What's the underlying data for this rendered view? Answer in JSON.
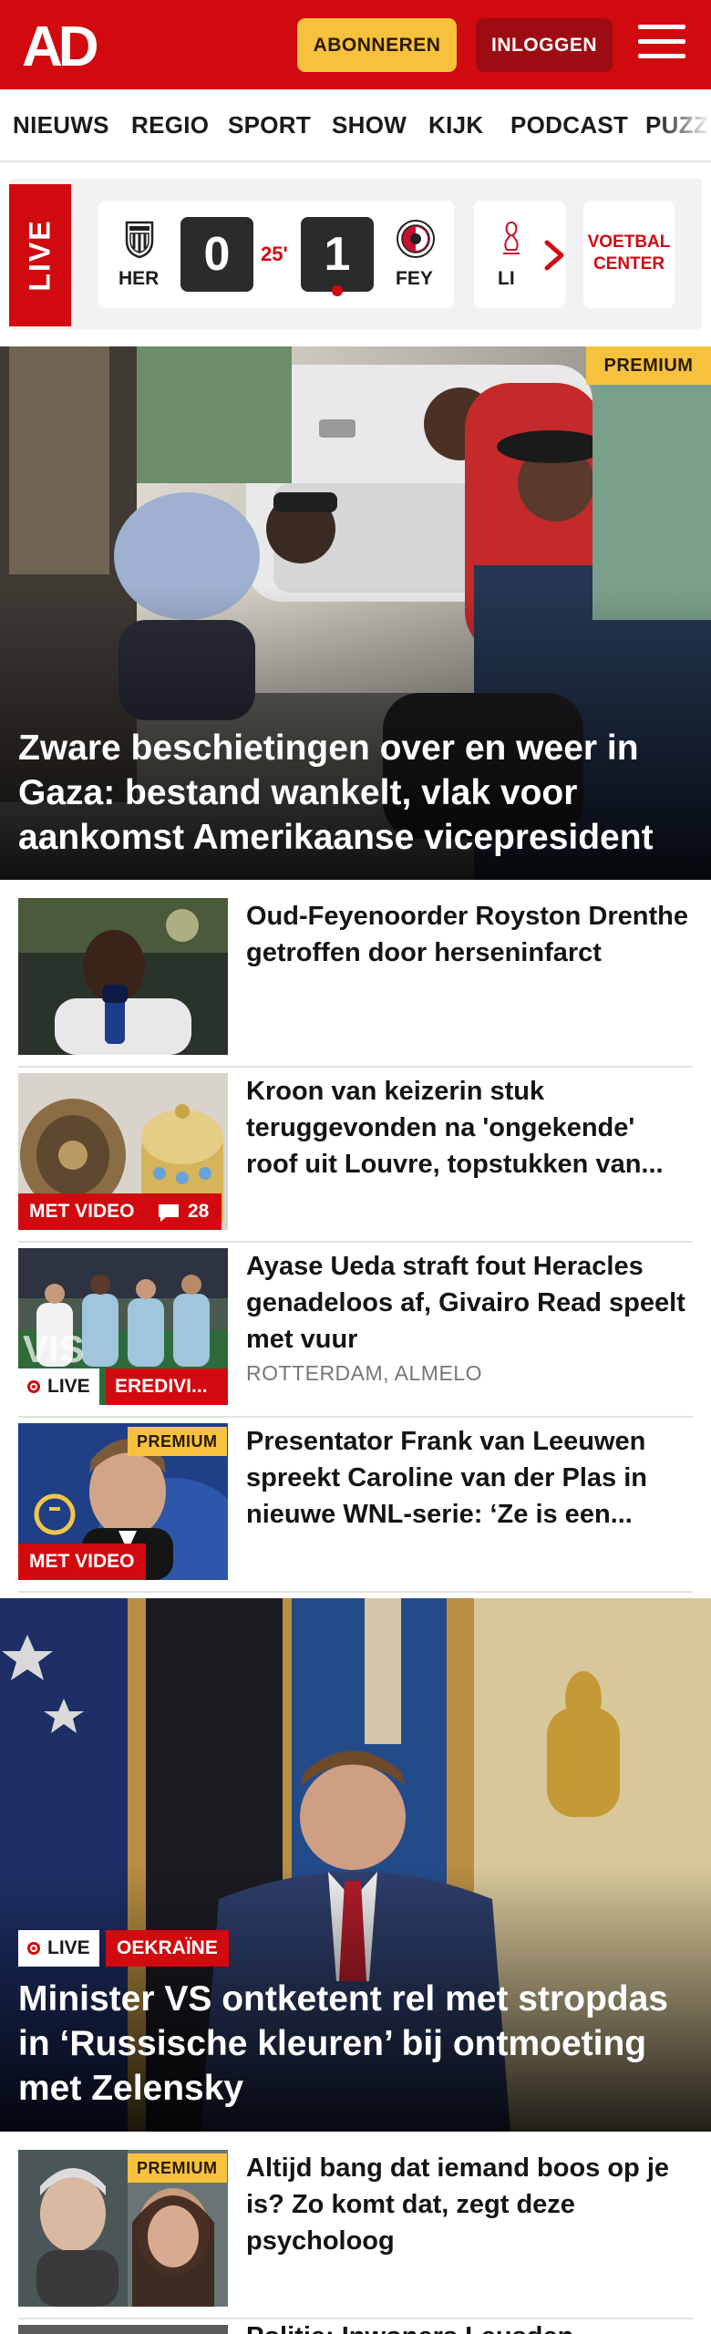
{
  "header": {
    "logo_text": "AD",
    "subscribe_label": "ABONNEREN",
    "login_label": "INLOGGEN"
  },
  "nav": {
    "items": [
      "NIEUWS",
      "REGIO",
      "SPORT",
      "SHOW",
      "KIJK",
      "PODCAST",
      "PUZZ"
    ]
  },
  "live": {
    "label": "LIVE",
    "match": {
      "home_code": "HER",
      "away_code": "FEY",
      "home_score": "0",
      "away_score": "1",
      "minute": "25'"
    },
    "next_match_code": "LI",
    "center_label_line1": "VOETBAL",
    "center_label_line2": "CENTER"
  },
  "hero": {
    "badge": "PREMIUM",
    "title": "Zware beschietingen over en weer in Gaza: bestand wankelt, vlak voor aankomst Amerikaanse vicepresident"
  },
  "articles": [
    {
      "title": "Oud-Feyenoorder Royston Drenthe getroffen door hersen­infarct"
    },
    {
      "title": "Kroon van keizerin stuk teruggevonden na 'ongekende' roof uit Louvre, topstukken van...",
      "video_label": "MET VIDEO",
      "comments": "28"
    },
    {
      "title": "Ayase Ueda straft fout Heracles genadeloos af, Givairo Read speelt met vuur",
      "live_label": "LIVE",
      "category": "EREDIVI...",
      "location": "ROTTERDAM, ALMELO"
    },
    {
      "title": "Presentator Frank van Leeuwen spreekt Caroline van der Plas in nieuwe WNL-serie: ‘Ze is een...",
      "premium_label": "PREMIUM",
      "video_label": "MET VIDEO"
    }
  ],
  "story": {
    "live_label": "LIVE",
    "category": "OEKRAÏNE",
    "title": "Minister VS ontketent rel met stropdas in ‘Russische kleuren’ bij ontmoeting met Zelensky"
  },
  "articles2": [
    {
      "title": "Altijd bang dat iemand boos op je is? Zo komt dat, zegt deze psycholoog",
      "premium_label": "PREMIUM"
    },
    {
      "title": "Politie: Inwoners Leusden"
    }
  ],
  "colors": {
    "brand_red": "#d10a10",
    "premium_yellow": "#f6c23d",
    "login_dark_red": "#9c0c12"
  }
}
